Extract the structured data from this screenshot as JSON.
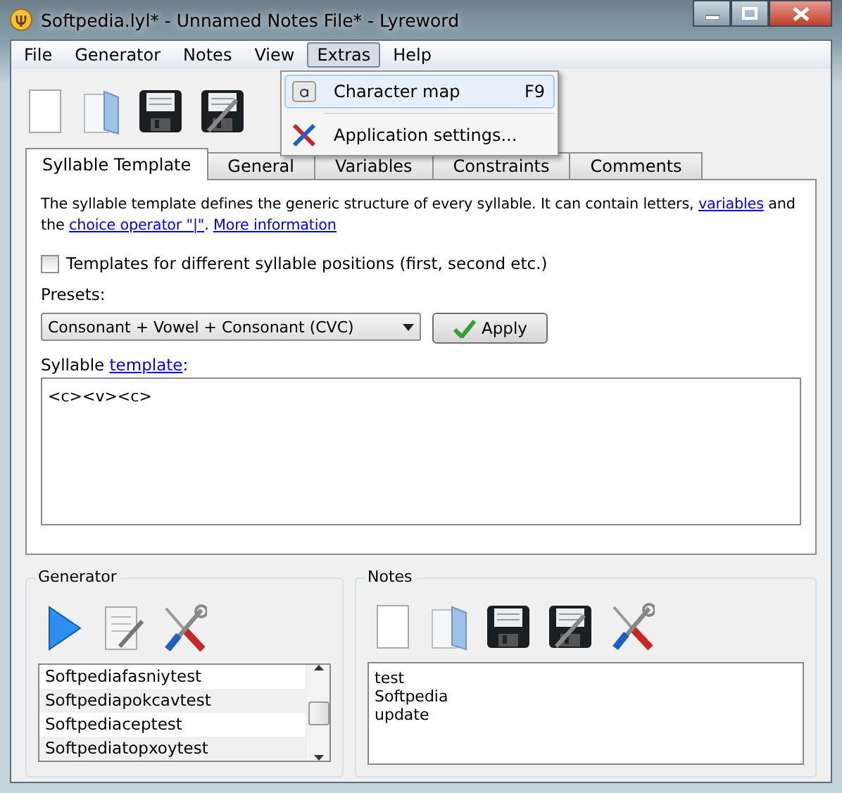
{
  "window": {
    "title": "Softpedia.lyl* - Unnamed Notes File* - Lyreword"
  },
  "menu": [
    {
      "label": "File",
      "selected": false
    },
    {
      "label": "Generator",
      "selected": false
    },
    {
      "label": "Notes",
      "selected": false
    },
    {
      "label": "View",
      "selected": false
    },
    {
      "label": "Extras",
      "selected": true
    },
    {
      "label": "Help",
      "selected": false
    }
  ],
  "dropdown": [
    {
      "kind": "charmap",
      "label": "Character map",
      "shortcut": "F9",
      "selected": true
    },
    {
      "kind": "settings",
      "label": "Application settings...",
      "selected": false
    }
  ],
  "tabs": [
    {
      "label": "Syllable Template",
      "selected": true
    },
    {
      "label": "General",
      "selected": false
    },
    {
      "label": "Variables",
      "selected": false
    },
    {
      "label": "Constraints",
      "selected": false
    },
    {
      "label": "Comments",
      "selected": false
    }
  ],
  "description": [
    {
      "kind": "text",
      "text": "The syllable template defines the generic structure of every syllable. It can contain letters, "
    },
    {
      "kind": "link",
      "text": "variables"
    },
    {
      "kind": "text",
      "text": " and the "
    },
    {
      "kind": "link",
      "text": "choice operator \"|\""
    },
    {
      "kind": "text",
      "text": ". "
    },
    {
      "kind": "link",
      "text": "More information"
    }
  ],
  "position_checkbox": {
    "label": "Templates for different syllable positions (first, second etc.)",
    "checked": false
  },
  "presets": {
    "label": "Presets:",
    "value": "Consonant + Vowel + Consonant (CVC)",
    "button": "Apply"
  },
  "template": {
    "label": [
      {
        "kind": "text",
        "text": "Syllable "
      },
      {
        "kind": "link",
        "text": "template"
      },
      {
        "kind": "text",
        "text": ":"
      }
    ],
    "value": "<c><v><c>"
  },
  "generator": {
    "title": "Generator",
    "words": [
      "Softpediafasniytest",
      "Softpediapokcavtest",
      "Softpediaceptest",
      "Softpediatopxoytest"
    ]
  },
  "notes": {
    "title": "Notes",
    "lines": [
      "test",
      "Softpedia",
      "update"
    ]
  }
}
